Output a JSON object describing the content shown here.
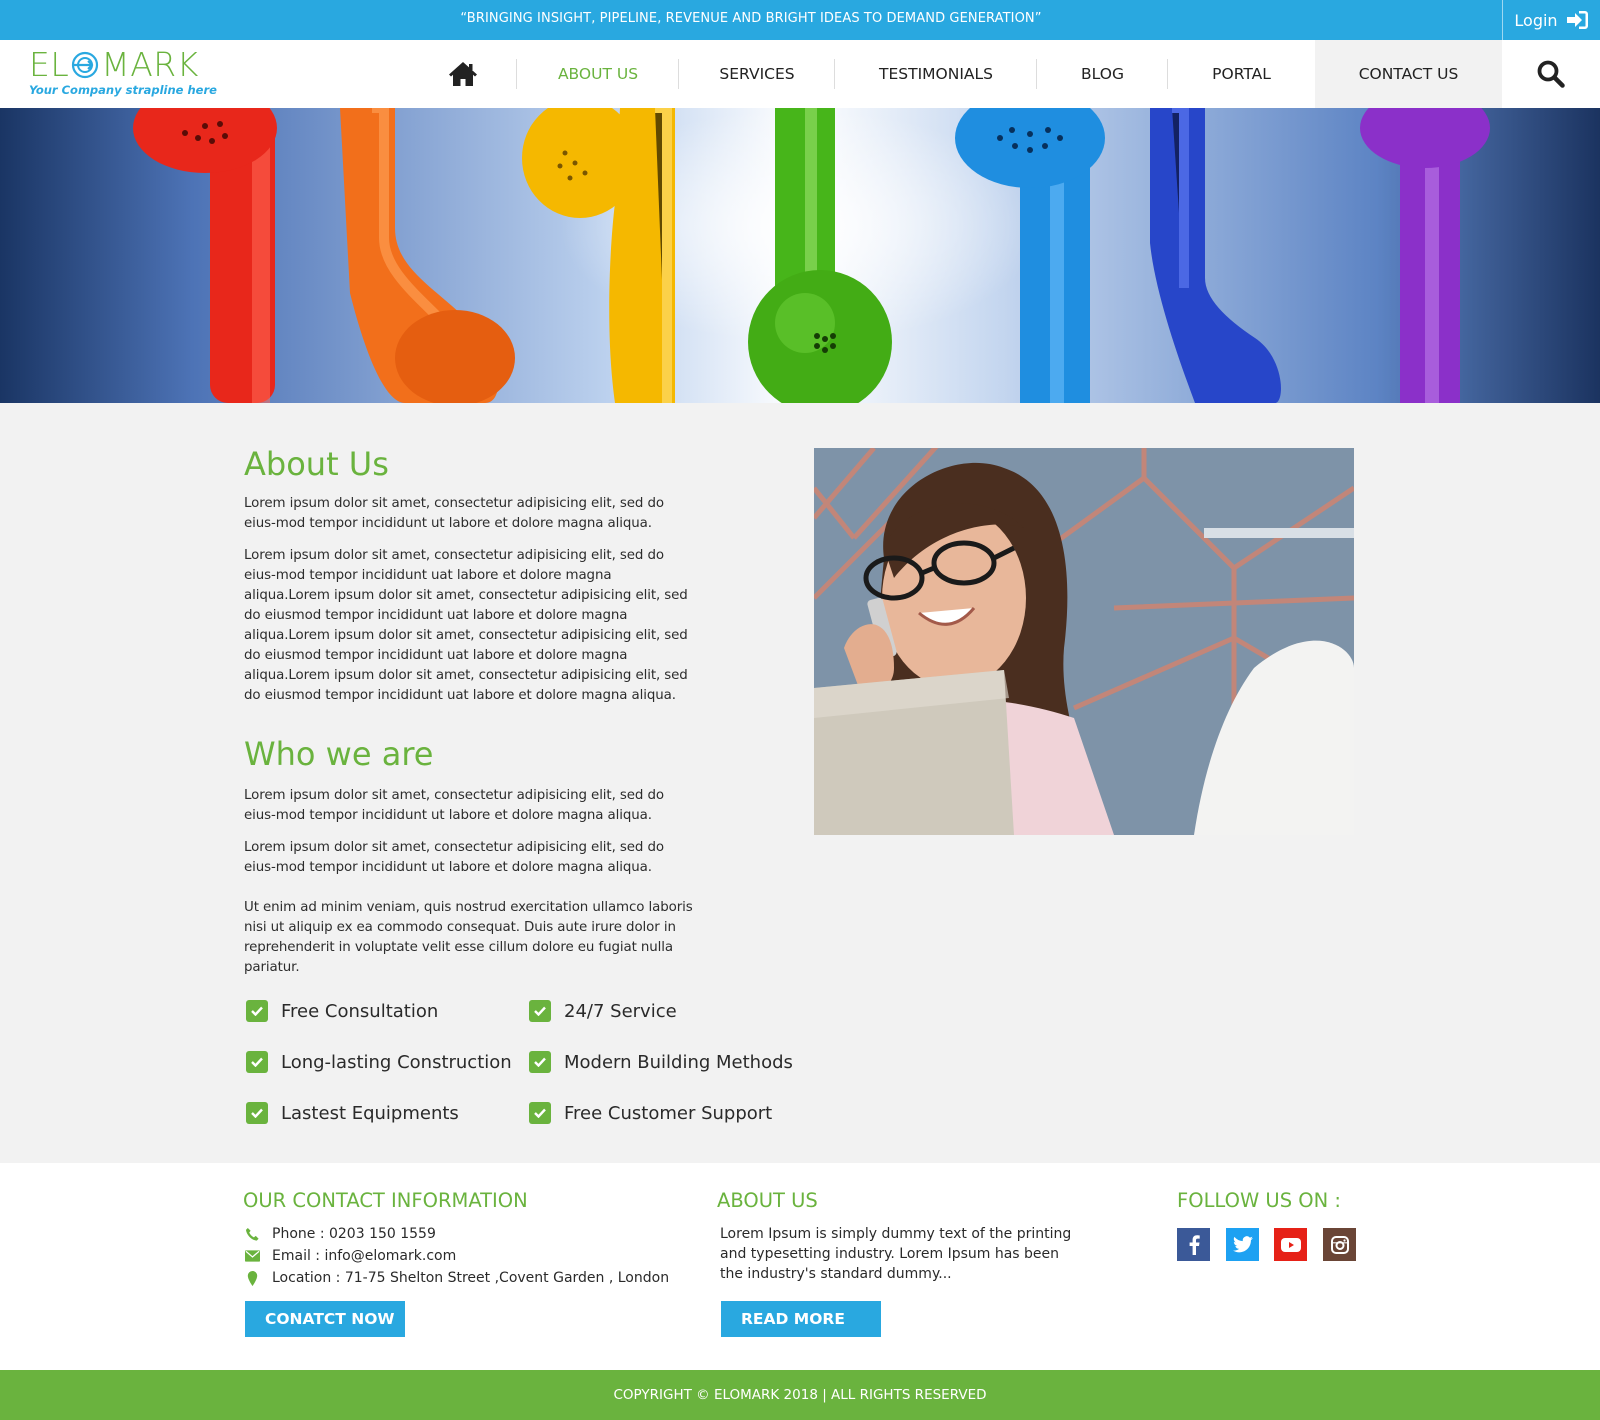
{
  "topbar": {
    "slogan": "“BRINGING INSIGHT, PIPELINE, REVENUE AND BRIGHT IDEAS TO DEMAND GENERATION”",
    "login_label": "Login",
    "login_icon": "sign-in-icon"
  },
  "logo": {
    "wordmark_left": "EL",
    "wordmark_right": "MARK",
    "strapline": "Your Company strapline here"
  },
  "nav": {
    "home_icon": "home-icon",
    "items": [
      {
        "label": "ABOUT US"
      },
      {
        "label": "SERVICES"
      },
      {
        "label": "TESTIMONIALS"
      },
      {
        "label": "BLOG"
      },
      {
        "label": "PORTAL"
      },
      {
        "label": "CONTACT US"
      }
    ],
    "search_icon": "search-icon"
  },
  "colors": {
    "brand_green": "#6ab33e",
    "brand_blue": "#29a8e0"
  },
  "about": {
    "heading": "About Us",
    "paragraphs": [
      "Lorem ipsum dolor sit amet, consectetur adipisicing elit, sed do eius-mod tempor incididunt ut labore et dolore magna aliqua.",
      "Lorem ipsum dolor sit amet, consectetur adipisicing elit, sed do eius-mod tempor incididunt uat labore et dolore magna aliqua.Lorem ipsum dolor sit amet, consectetur adipisicing elit, sed do eiusmod tempor incididunt uat labore et dolore magna aliqua.Lorem ipsum dolor sit amet, consectetur adipisicing elit, sed do eiusmod tempor incididunt uat labore et dolore magna aliqua.Lorem ipsum dolor sit amet, consectetur adipisicing elit, sed do eiusmod tempor incididunt uat labore et dolore magna aliqua."
    ]
  },
  "who": {
    "heading": "Who we are",
    "paragraphs": [
      "Lorem ipsum dolor sit amet, consectetur adipisicing elit, sed do eius-mod tempor incididunt ut labore et dolore magna aliqua.",
      "Lorem ipsum dolor sit amet, consectetur adipisicing elit, sed do eius-mod tempor incididunt ut labore et dolore magna aliqua.",
      "Ut enim ad minim veniam, quis nostrud exercitation ullamco laboris nisi ut aliquip ex ea commodo consequat. Duis aute irure dolor in reprehenderit in voluptate velit esse cillum dolore eu fugiat nulla pariatur."
    ]
  },
  "features": [
    "Free Consultation",
    "24/7 Service",
    "Long-lasting Construction",
    "Modern Building Methods",
    "Lastest Equipments",
    "Free Customer Support"
  ],
  "footer": {
    "contact": {
      "title": "OUR CONTACT INFORMATION",
      "phone": "Phone : 0203 150 1559",
      "email": "Email : info@elomark.com",
      "location": "Location : 71-75 Shelton Street ,Covent Garden , London",
      "button": "CONATCT NOW"
    },
    "about": {
      "title": "ABOUT US",
      "text": "Lorem Ipsum is simply dummy text of the printing and typesetting industry. Lorem Ipsum has been the industry's standard dummy...",
      "button": "READ MORE"
    },
    "follow": {
      "title": "FOLLOW US ON :",
      "icons": [
        "facebook-icon",
        "twitter-icon",
        "youtube-icon",
        "instagram-icon"
      ]
    }
  },
  "copyright": "COPYRIGHT © ELOMARK 2018 | ALL RIGHTS RESERVED"
}
